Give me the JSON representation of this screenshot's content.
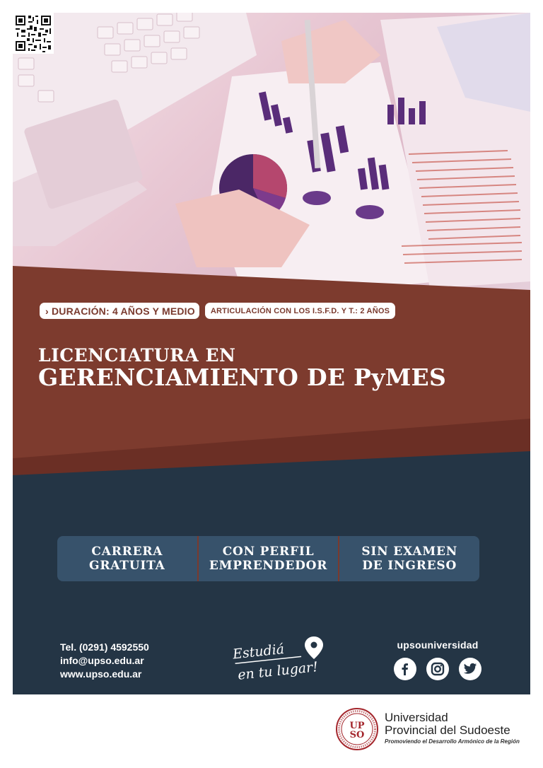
{
  "badges": {
    "duration": "› DURACIÓN: 4 AÑOS Y MEDIO",
    "articulation": "ARTICULACIÓN CON LOS I.S.F.D. Y T.: 2 AÑOS"
  },
  "title": {
    "line1": "LICENCIATURA EN",
    "line2": "GERENCIAMIENTO DE PyMES"
  },
  "features": [
    {
      "line1": "CARRERA",
      "line2": "GRATUITA"
    },
    {
      "line1": "CON PERFIL",
      "line2": "EMPRENDEDOR"
    },
    {
      "line1": "SIN EXAMEN",
      "line2": "DE INGRESO"
    }
  ],
  "contact": {
    "phone": "Tel. (0291) 4592550",
    "email": "info@upso.edu.ar",
    "web": "www.upso.edu.ar"
  },
  "slogan": {
    "line1": "Estudiá",
    "line2": "en tu lugar!"
  },
  "social": {
    "handle": "upsouniversidad",
    "icons": [
      "facebook-icon",
      "instagram-icon",
      "twitter-icon"
    ]
  },
  "university": {
    "seal_text": "UPSO",
    "name_line1": "Universidad",
    "name_line2": "Provincial del Sudoeste",
    "tagline": "Promoviendo el Desarrollo Armónico de la Región"
  },
  "colors": {
    "brown": "#7d3b2e",
    "navy": "#243545",
    "feature_bar": "#37526b",
    "accent_red": "#a4262c"
  }
}
